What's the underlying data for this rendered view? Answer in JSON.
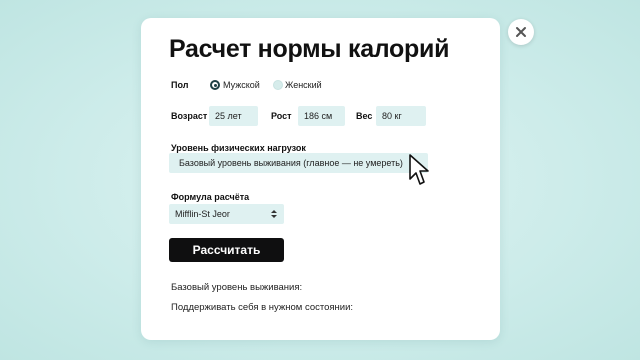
{
  "dialog": {
    "title": "Расчет нормы калорий",
    "close_icon": "close-icon"
  },
  "sex": {
    "label": "Пол",
    "options": [
      {
        "label": "Мужской",
        "selected": true
      },
      {
        "label": "Женский",
        "selected": false
      }
    ]
  },
  "age": {
    "label": "Возраст",
    "value": "25 лет"
  },
  "height": {
    "label": "Рост",
    "value": "186 см"
  },
  "weight": {
    "label": "Вес",
    "value": "80 кг"
  },
  "activity": {
    "label": "Уровень физических нагрузок",
    "value": "Базовый уровень выживания (главное — не умереть)"
  },
  "formula": {
    "label": "Формула расчёта",
    "value": "Mifflin-St Jeor"
  },
  "calculate_button": {
    "label": "Рассчитать"
  },
  "results": {
    "survival_label": "Базовый уровень выживания:",
    "maintain_label": "Поддерживать себя в нужном состоянии:"
  },
  "colors": {
    "background": "#cdecea",
    "field_bg": "#dff1f1",
    "button_bg": "#0f0f10",
    "radio_selected": "#1e3f45"
  }
}
